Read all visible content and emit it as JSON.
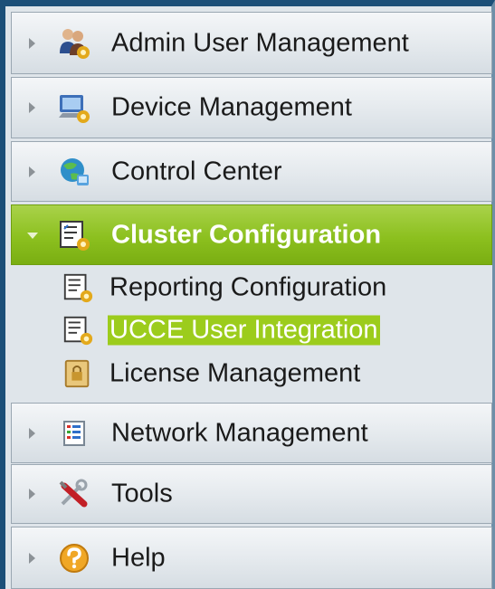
{
  "menu": {
    "items": [
      {
        "label": "Admin User Management",
        "icon": "admin-users-icon",
        "expanded": false
      },
      {
        "label": "Device Management",
        "icon": "device-management-icon",
        "expanded": false
      },
      {
        "label": "Control Center",
        "icon": "control-center-icon",
        "expanded": false
      },
      {
        "label": "Cluster Configuration",
        "icon": "cluster-configuration-icon",
        "expanded": true
      },
      {
        "label": "Network Management",
        "icon": "network-management-icon",
        "expanded": false
      },
      {
        "label": "Tools",
        "icon": "tools-icon",
        "expanded": false
      },
      {
        "label": "Help",
        "icon": "help-icon",
        "expanded": false
      }
    ],
    "cluster_children": [
      {
        "label": "Reporting Configuration",
        "icon": "reporting-configuration-icon",
        "selected": false
      },
      {
        "label": "UCCE User Integration",
        "icon": "ucce-user-integration-icon",
        "selected": true
      },
      {
        "label": "License Management",
        "icon": "license-management-icon",
        "selected": false
      }
    ]
  },
  "colors": {
    "active_header": "#8cc01f",
    "selected_item": "#9ccc1c",
    "frame": "#1c4f78"
  }
}
